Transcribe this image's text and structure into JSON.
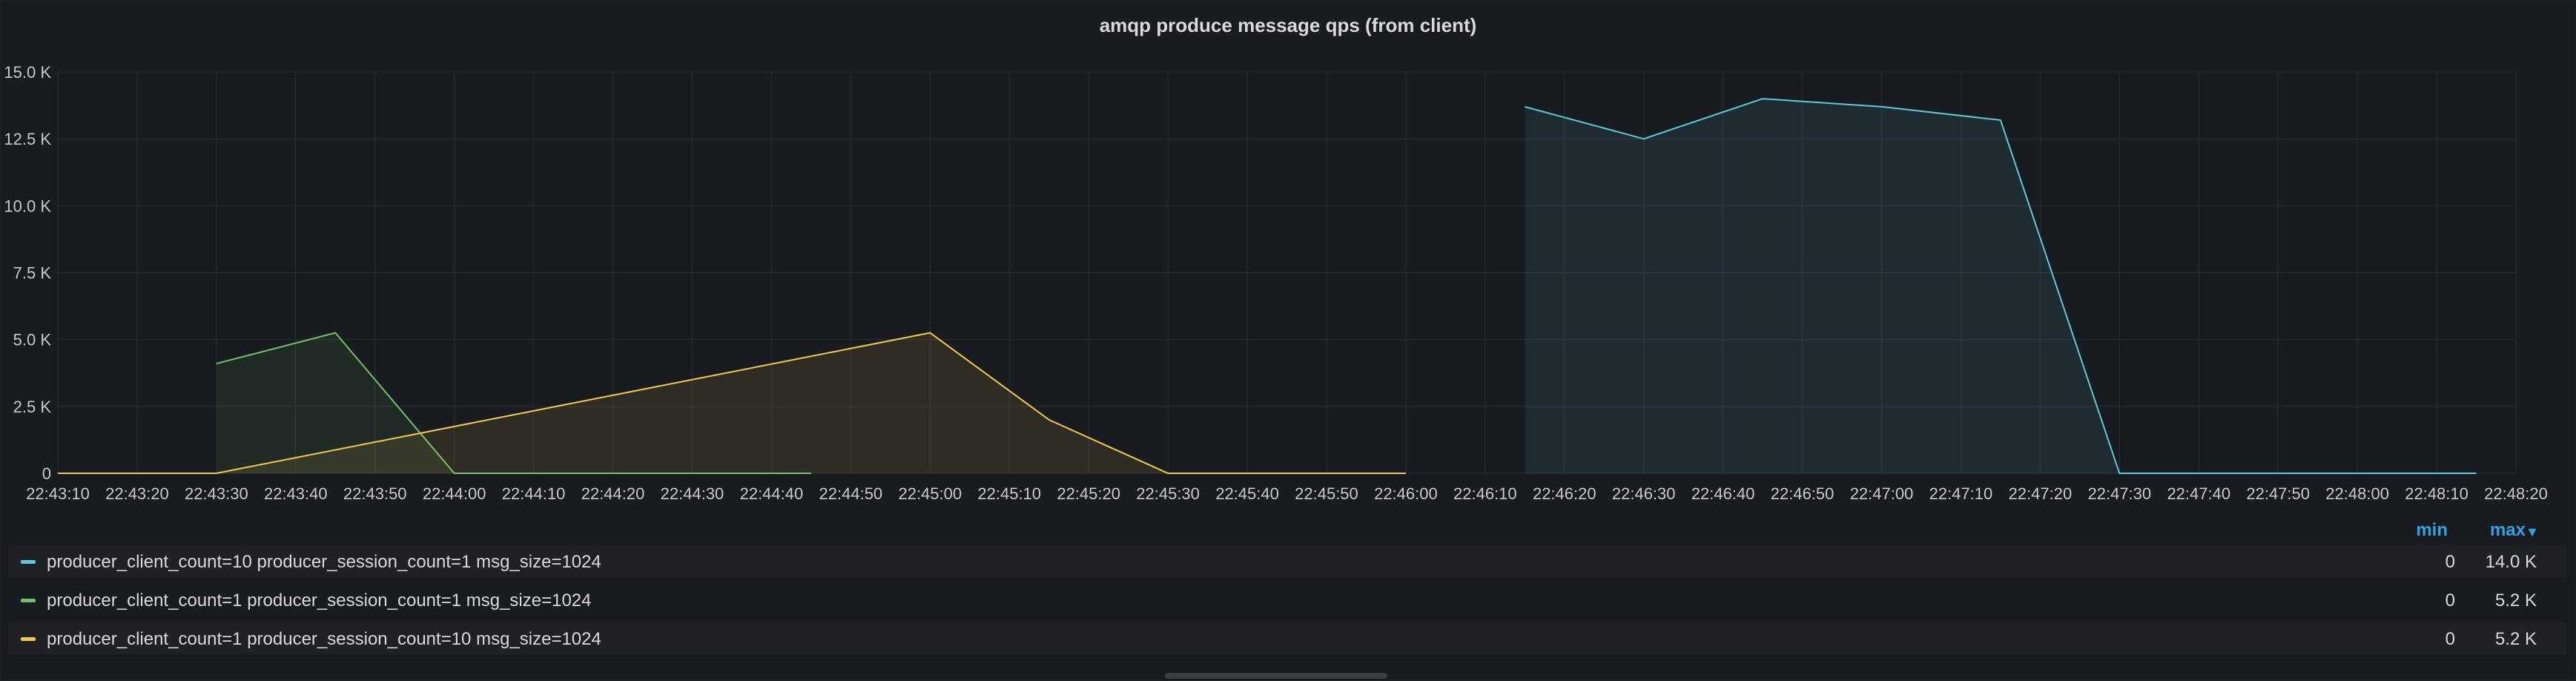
{
  "panel": {
    "title": "amqp produce message qps (from client)"
  },
  "legend": {
    "columns": {
      "min": "min",
      "max": "max"
    },
    "sort_icon": "caret-down-icon",
    "items": [
      {
        "label": "producer_client_count=10 producer_session_count=1 msg_size=1024",
        "min": "0",
        "max": "14.0 K",
        "color": "#5cc8dc"
      },
      {
        "label": "producer_client_count=1 producer_session_count=1 msg_size=1024",
        "min": "0",
        "max": "5.2 K",
        "color": "#73bf69"
      },
      {
        "label": "producer_client_count=1 producer_session_count=10 msg_size=1024",
        "min": "0",
        "max": "5.2 K",
        "color": "#f2c94c"
      }
    ]
  },
  "chart_data": {
    "type": "area",
    "title": "amqp produce message qps (from client)",
    "xlabel": "",
    "ylabel": "",
    "ylim": [
      0,
      15000
    ],
    "xlim": [
      "22:43:10",
      "22:48:20"
    ],
    "y_ticks": [
      "0",
      "2.5 K",
      "5.0 K",
      "7.5 K",
      "10.0 K",
      "12.5 K",
      "15.0 K"
    ],
    "x_ticks": [
      "22:43:10",
      "22:43:20",
      "22:43:30",
      "22:43:40",
      "22:43:50",
      "22:44:00",
      "22:44:10",
      "22:44:20",
      "22:44:30",
      "22:44:40",
      "22:44:50",
      "22:45:00",
      "22:45:10",
      "22:45:20",
      "22:45:30",
      "22:45:40",
      "22:45:50",
      "22:46:00",
      "22:46:10",
      "22:46:20",
      "22:46:30",
      "22:46:40",
      "22:46:50",
      "22:47:00",
      "22:47:10",
      "22:47:20",
      "22:47:30",
      "22:47:40",
      "22:47:50",
      "22:48:00",
      "22:48:10",
      "22:48:20"
    ],
    "grid": true,
    "legend_position": "bottom",
    "series": [
      {
        "name": "producer_client_count=10 producer_session_count=1 msg_size=1024",
        "color": "#5cc8dc",
        "points": [
          [
            "22:46:15",
            13700
          ],
          [
            "22:46:30",
            12500
          ],
          [
            "22:46:45",
            14000
          ],
          [
            "22:47:00",
            13700
          ],
          [
            "22:47:15",
            13200
          ],
          [
            "22:47:30",
            0
          ],
          [
            "22:48:15",
            0
          ]
        ]
      },
      {
        "name": "producer_client_count=1 producer_session_count=1 msg_size=1024",
        "color": "#73bf69",
        "points": [
          [
            "22:43:30",
            4100
          ],
          [
            "22:43:45",
            5250
          ],
          [
            "22:44:00",
            0
          ],
          [
            "22:44:45",
            0
          ]
        ]
      },
      {
        "name": "producer_client_count=1 producer_session_count=10 msg_size=1024",
        "color": "#f2c94c",
        "points": [
          [
            "22:43:10",
            0
          ],
          [
            "22:43:30",
            0
          ],
          [
            "22:45:00",
            5250
          ],
          [
            "22:45:15",
            2000
          ],
          [
            "22:45:30",
            0
          ],
          [
            "22:46:00",
            0
          ]
        ]
      }
    ]
  }
}
